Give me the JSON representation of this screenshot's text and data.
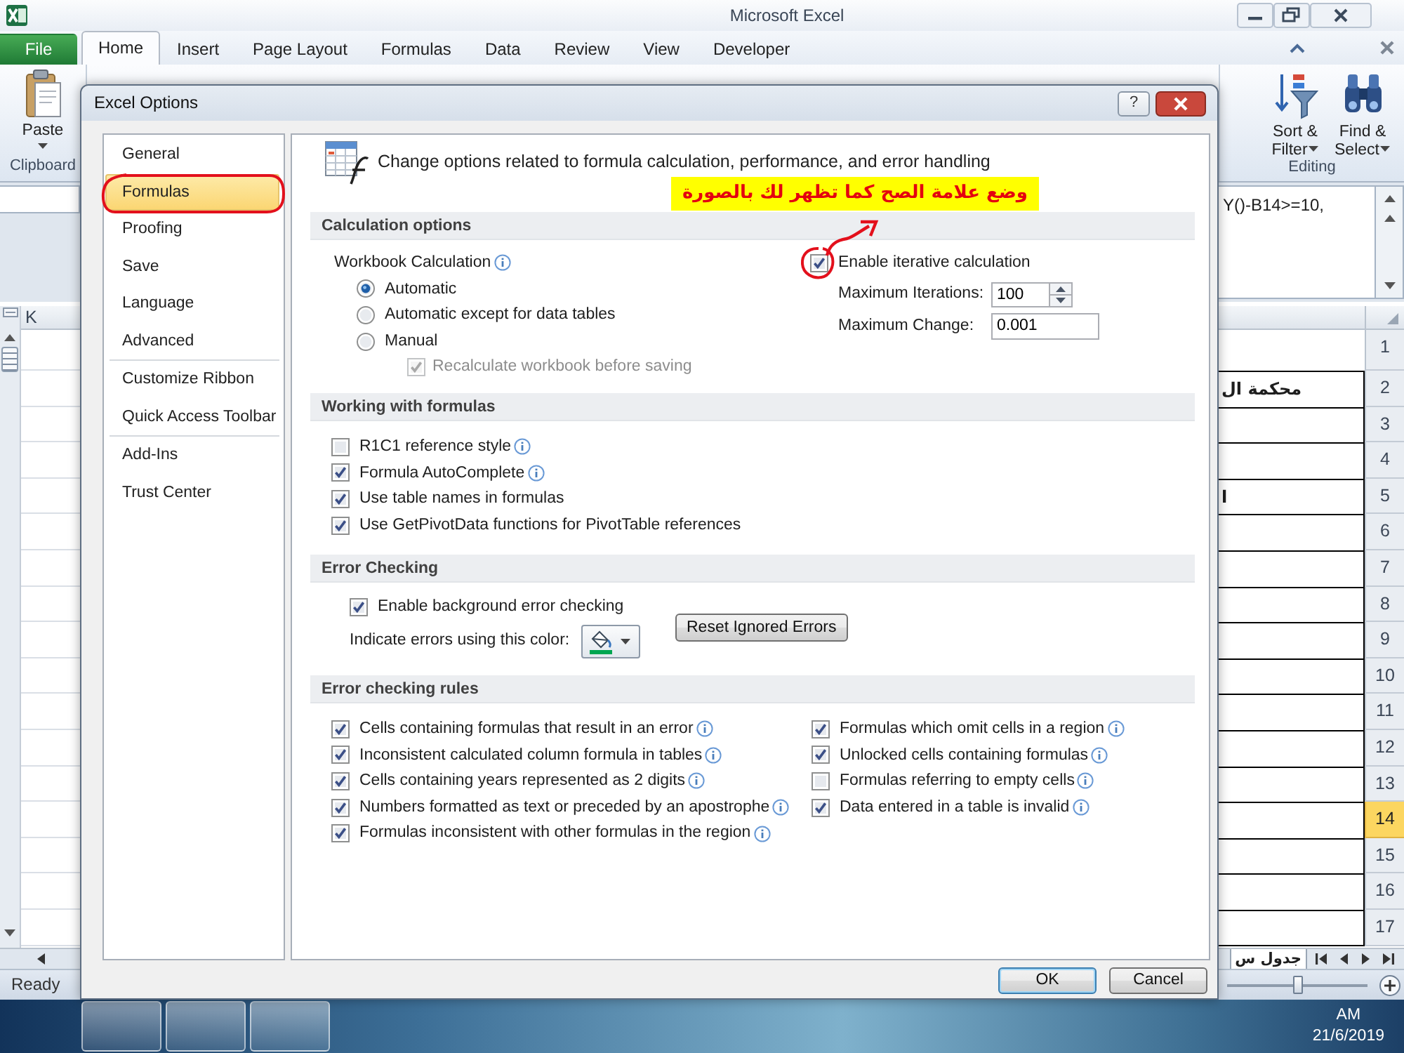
{
  "excel": {
    "title": "Microsoft Excel",
    "tabs": [
      {
        "label": "File",
        "kind": "backstage",
        "selected": false
      },
      {
        "label": "Home",
        "kind": "tab",
        "selected": true
      },
      {
        "label": "Insert",
        "kind": "tab",
        "selected": false
      },
      {
        "label": "Page Layout",
        "kind": "tab",
        "selected": false
      },
      {
        "label": "Formulas",
        "kind": "tab",
        "selected": false
      },
      {
        "label": "Data",
        "kind": "tab",
        "selected": false
      },
      {
        "label": "Review",
        "kind": "tab",
        "selected": false
      },
      {
        "label": "View",
        "kind": "tab",
        "selected": false
      },
      {
        "label": "Developer",
        "kind": "tab",
        "selected": false
      }
    ],
    "ribbon": {
      "clipboard": {
        "button": "Paste",
        "label": "Clipboard"
      },
      "editing": {
        "buttons": [
          {
            "label": "Sort & Filter",
            "kind": "sort"
          },
          {
            "label": "Find & Select",
            "kind": "find"
          }
        ],
        "label": "Editing"
      }
    },
    "formula_text": "Y()-B14>=10,",
    "column_header": "K",
    "rows": [
      {
        "number": "1",
        "selected": false,
        "bordered": false
      },
      {
        "number": "2",
        "text": "محكمة ال",
        "selected": false,
        "bordered": true
      },
      {
        "number": "3",
        "selected": false,
        "bordered": true
      },
      {
        "number": "4",
        "selected": false,
        "bordered": true
      },
      {
        "number": "5",
        "text": "ا",
        "selected": false,
        "bordered": true
      },
      {
        "number": "6",
        "selected": false,
        "bordered": true
      },
      {
        "number": "7",
        "selected": false,
        "bordered": true
      },
      {
        "number": "8",
        "selected": false,
        "bordered": true
      },
      {
        "number": "9",
        "selected": false,
        "bordered": true
      },
      {
        "number": "10",
        "selected": false,
        "bordered": true
      },
      {
        "number": "11",
        "selected": false,
        "bordered": true
      },
      {
        "number": "12",
        "selected": false,
        "bordered": true
      },
      {
        "number": "13",
        "selected": false,
        "bordered": true
      },
      {
        "number": "14",
        "selected": true,
        "bordered": true
      },
      {
        "number": "15",
        "selected": false,
        "bordered": true
      },
      {
        "number": "16",
        "selected": false,
        "bordered": true
      },
      {
        "number": "17",
        "selected": false,
        "bordered": true
      }
    ],
    "sheet_tab": "جدول س",
    "status": "Ready",
    "zoom_slider": {
      "level": 0.5
    },
    "clock": {
      "time": "AM",
      "date": "21/6/2019"
    }
  },
  "dialog": {
    "title": "Excel Options",
    "help": "?",
    "nav": [
      {
        "items": [
          {
            "label": "General",
            "selected": false,
            "circled": false
          },
          {
            "label": "Formulas",
            "selected": true,
            "circled": true
          },
          {
            "label": "Proofing",
            "selected": false,
            "circled": false
          },
          {
            "label": "Save",
            "selected": false,
            "circled": false
          },
          {
            "label": "Language",
            "selected": false,
            "circled": false
          },
          {
            "label": "Advanced",
            "selected": false,
            "circled": false
          }
        ]
      },
      {
        "items": [
          {
            "label": "Customize Ribbon",
            "selected": false,
            "circled": false
          },
          {
            "label": "Quick Access Toolbar",
            "selected": false,
            "circled": false
          }
        ]
      },
      {
        "items": [
          {
            "label": "Add-Ins",
            "selected": false,
            "circled": false
          },
          {
            "label": "Trust Center",
            "selected": false,
            "circled": false
          }
        ]
      }
    ],
    "heading": "Change options related to formula calculation, performance, and error handling",
    "sections": [
      {
        "kind": "calculation",
        "title": "Calculation options",
        "workbook_calculation": {
          "label": "Workbook Calculation",
          "info": true
        },
        "modes": [
          {
            "label": "Automatic",
            "selected": true
          },
          {
            "label": "Automatic except for data tables",
            "selected": false
          },
          {
            "label": "Manual",
            "selected": false
          }
        ],
        "recalculate": {
          "label": "Recalculate workbook before saving",
          "checked": true,
          "disabled": true
        },
        "iterative": {
          "label": "Enable iterative calculation",
          "checked": true,
          "circled": true
        },
        "limits": [
          {
            "label": "Maximum Iterations:",
            "value": "100",
            "kind": "spinner"
          },
          {
            "label": "Maximum Change:",
            "value": "0.001",
            "kind": "text"
          }
        ]
      },
      {
        "kind": "checklist",
        "title": "Working with formulas",
        "items": [
          {
            "label": "R1C1 reference style",
            "checked": false,
            "info": true
          },
          {
            "label": "Formula AutoComplete",
            "checked": true,
            "info": true
          },
          {
            "label": "Use table names in formulas",
            "checked": true,
            "info": false
          },
          {
            "label": "Use GetPivotData functions for PivotTable references",
            "checked": true,
            "info": false
          }
        ]
      },
      {
        "kind": "error_checking",
        "title": "Error Checking",
        "background_checking": {
          "label": "Enable background error checking",
          "checked": true
        },
        "color_picker": {
          "label": "Indicate errors using this color:",
          "color": "#00a651"
        },
        "reset_button": "Reset Ignored Errors"
      },
      {
        "kind": "rules",
        "title": "Error checking rules",
        "columns": [
          {
            "items": [
              {
                "label": "Cells containing formulas that result in an error",
                "checked": true,
                "info": true
              },
              {
                "label": "Inconsistent calculated column formula in tables",
                "checked": true,
                "info": true
              },
              {
                "label": "Cells containing years represented as 2 digits",
                "checked": true,
                "info": true
              },
              {
                "label": "Numbers formatted as text or preceded by an apostrophe",
                "checked": true,
                "info": true
              },
              {
                "label": "Formulas inconsistent with other formulas in the region",
                "checked": true,
                "info": true
              }
            ]
          },
          {
            "items": [
              {
                "label": "Formulas which omit cells in a region",
                "checked": true,
                "info": true
              },
              {
                "label": "Unlocked cells containing formulas",
                "checked": true,
                "info": true
              },
              {
                "label": "Formulas referring to empty cells",
                "checked": false,
                "info": true
              },
              {
                "label": "Data entered in a table is invalid",
                "checked": true,
                "info": true
              }
            ]
          }
        ]
      }
    ],
    "buttons": [
      {
        "label": "OK",
        "focused": true
      },
      {
        "label": "Cancel",
        "focused": false
      }
    ]
  },
  "annotation": {
    "note": "وضع علامة الصح كما تظهر لك بالصورة"
  }
}
